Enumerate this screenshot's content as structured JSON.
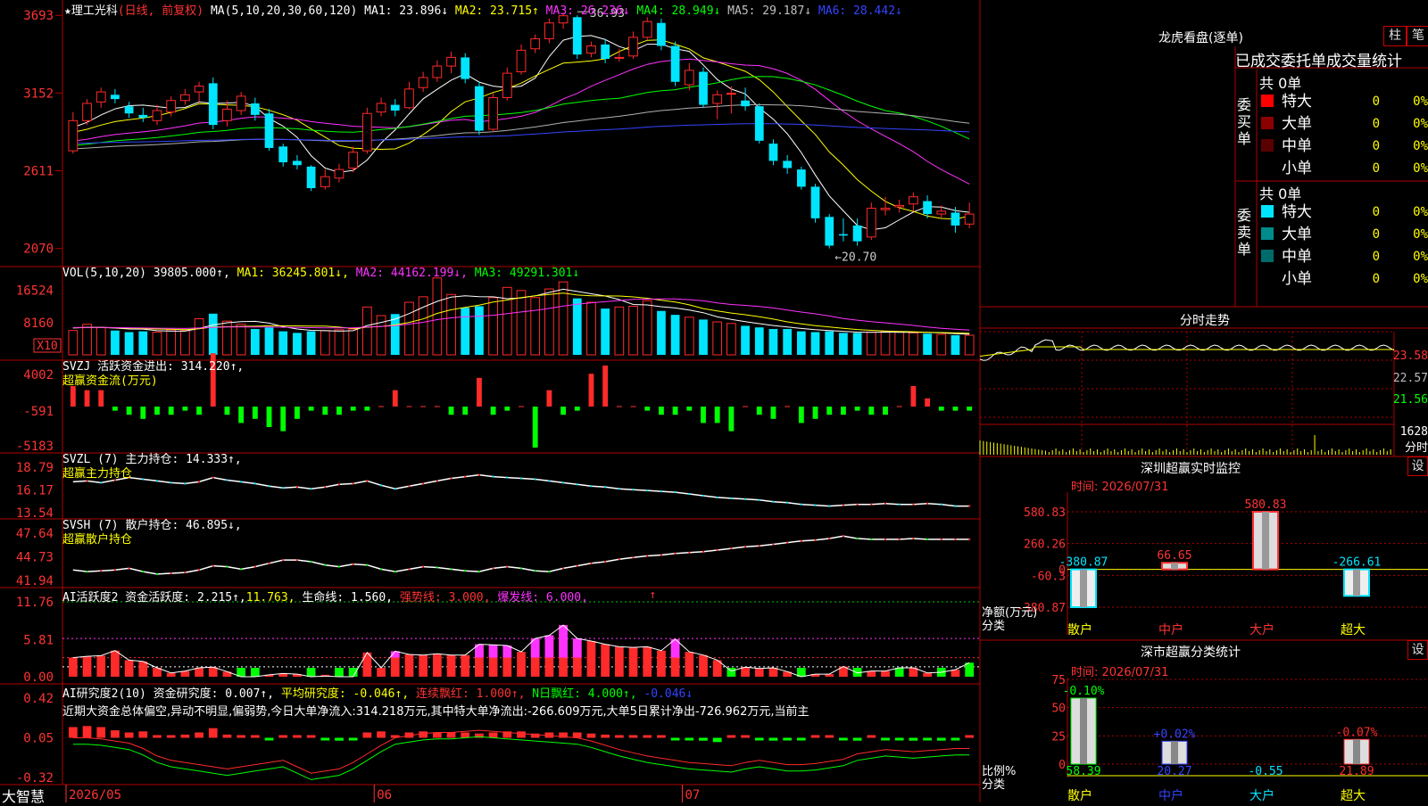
{
  "colors": {
    "bg": "#000000",
    "grid": "#b00000",
    "up": "#ff2a2a",
    "down": "#00e5ff",
    "ma1": "#ffffff",
    "ma2": "#ffff00",
    "ma3": "#ff33ff",
    "ma4": "#00ff00",
    "ma5": "#b0b0b0",
    "ma6": "#3344ff",
    "green": "#00ff00",
    "magenta": "#ff33ff",
    "yellow": "#ffff00"
  },
  "header": {
    "stock": "★理工光科",
    "mode": "(日线, 前复权)",
    "ma_params": "MA(5,10,20,30,60,120)",
    "ma1": "MA1: 23.896↓",
    "ma2": "MA2: 23.715↑",
    "ma3": "MA3: 26.236↓",
    "ma4": "MA4: 28.949↓",
    "ma5": "MA5: 29.187↓",
    "ma6": "MA6: 28.442↓"
  },
  "price_axis": [
    "3693",
    "3152",
    "2611",
    "2070"
  ],
  "price_annotations": {
    "high": "36.93",
    "low": "←20.70"
  },
  "vol": {
    "label": "VOL(5,10,20) 39805.000↑,",
    "ma1": "MA1: 36245.801↓,",
    "ma2": "MA2: 44162.199↓,",
    "ma3": "MA3: 49291.301↓",
    "axis": [
      "16524",
      "8160"
    ],
    "unit": "X10"
  },
  "svzj": {
    "label": "SVZJ  活跃资金进出: 314.220↑,",
    "sub": "超赢资金流(万元)",
    "axis": [
      "4002",
      "-591",
      "-5183"
    ]
  },
  "svzl": {
    "label": "SVZL (7) 主力持仓: 14.333↑,",
    "sub": "超赢主力持仓",
    "axis": [
      "18.79",
      "16.17",
      "13.54"
    ]
  },
  "svsh": {
    "label": "SVSH (7) 散户持仓: 46.895↓,",
    "sub": "超赢散户持仓",
    "axis": [
      "47.64",
      "44.73",
      "41.94"
    ]
  },
  "ai1": {
    "label": "AI活跃度2 资金活跃度: 2.215↑,",
    "v2": "11.763,",
    "life": "生命线: 1.560,",
    "strong": "强势线: 3.000,",
    "burst": "爆发线: 6.000,",
    "axis": [
      "11.76",
      "5.81",
      "0.00"
    ]
  },
  "ai2": {
    "label": "AI研究度2(10) 资金研究度: 0.007↑,",
    "avg": "平均研究度: -0.046↑,",
    "red": "连续飘红: 1.000↑,",
    "nday": "N日飘红: 4.000↑,",
    "last": "-0.046↓",
    "axis": [
      "0.42",
      "0.05",
      "-0.32"
    ],
    "commentary": "近期大资金总体偏空,异动不明显,偏弱势,今日大单净流入:314.218万元,其中特大单净流出:-266.609万元,大单5日累计净出-726.962万元,当前主"
  },
  "date_axis": [
    "2026/05",
    "06",
    "07"
  ],
  "brand": "大智慧",
  "right_panel": {
    "title": "龙虎看盘(逐单)",
    "btn1": "柱",
    "btn2": "笔",
    "tabs": "已成交委托单成交量统计",
    "buy_label": "委买单",
    "sell_label": "委卖单",
    "buy_total": "共 0单",
    "sell_total": "共 0单",
    "buy_rows": [
      {
        "name": "特大",
        "count": "0",
        "pct": "0%",
        "color": "#ff0000"
      },
      {
        "name": "大单",
        "count": "0",
        "pct": "0%",
        "color": "#8b0000"
      },
      {
        "name": "中单",
        "count": "0",
        "pct": "0%",
        "color": "#5a0000"
      },
      {
        "name": "小单",
        "count": "0",
        "pct": "0%",
        "color": "#000000"
      }
    ],
    "sell_rows": [
      {
        "name": "特大",
        "count": "0",
        "pct": "0%",
        "color": "#00e5ff"
      },
      {
        "name": "大单",
        "count": "0",
        "pct": "0%",
        "color": "#008b8b"
      },
      {
        "name": "中单",
        "count": "0",
        "pct": "0%",
        "color": "#006b6b"
      },
      {
        "name": "小单",
        "count": "0",
        "pct": "0%",
        "color": "#000000"
      }
    ],
    "intraday": {
      "title": "分时走势",
      "axis": [
        "23.58",
        "22.57",
        "21.56"
      ],
      "vol": "1628",
      "vol_unit": "分时"
    },
    "sz_monitor": {
      "title": "深圳超赢实时监控",
      "time": "时间: 2026/07/31",
      "btn": "设",
      "axis": [
        "580.83",
        "260.26",
        "0",
        "-60.3",
        "-380.87"
      ],
      "ylabel": "净额(万元)",
      "xlabel": "分类",
      "cats": [
        "散户",
        "中户",
        "大户",
        "超大"
      ],
      "values": [
        "-380.87",
        "66.65",
        "580.83",
        "-266.61"
      ]
    },
    "sz_class": {
      "title": "深市超赢分类统计",
      "time": "时间: 2026/07/31",
      "btn": "设",
      "axis": [
        "75",
        "50",
        "25",
        "0"
      ],
      "ylabel": "比例%",
      "xlabel": "分类",
      "cats": [
        "散户",
        "中户",
        "大户",
        "超大"
      ],
      "top": [
        "-0.10%",
        "+0.02%",
        "",
        "-0.07%"
      ],
      "bottom": [
        "58.39",
        "20.27",
        "-0.55",
        "21.89"
      ]
    }
  },
  "chart_data": {
    "type": "line",
    "title": "理工光科",
    "candles": [
      [
        27.5,
        29.6,
        30.2,
        27.3
      ],
      [
        29.6,
        30.8,
        31.1,
        29.3
      ],
      [
        30.9,
        31.6,
        31.9,
        30.5
      ],
      [
        31.4,
        31.1,
        31.8,
        30.8
      ],
      [
        30.6,
        30.1,
        30.9,
        29.8
      ],
      [
        30.0,
        29.8,
        30.5,
        29.5
      ],
      [
        29.6,
        30.3,
        30.7,
        29.3
      ],
      [
        30.2,
        31.0,
        31.3,
        29.9
      ],
      [
        31.0,
        31.4,
        31.8,
        30.7
      ],
      [
        31.6,
        32.0,
        32.3,
        30.9
      ],
      [
        32.2,
        29.3,
        32.6,
        29.0
      ],
      [
        29.6,
        30.4,
        31.0,
        29.2
      ],
      [
        30.3,
        31.3,
        31.6,
        30.0
      ],
      [
        30.8,
        30.0,
        31.2,
        29.6
      ],
      [
        30.1,
        27.7,
        30.4,
        27.5
      ],
      [
        27.8,
        26.7,
        28.0,
        26.4
      ],
      [
        26.8,
        26.5,
        27.2,
        26.2
      ],
      [
        26.4,
        24.9,
        26.5,
        24.7
      ],
      [
        25.0,
        25.7,
        26.2,
        24.8
      ],
      [
        25.6,
        26.2,
        26.6,
        25.3
      ],
      [
        26.3,
        27.4,
        27.8,
        26.0
      ],
      [
        27.5,
        30.1,
        30.5,
        27.3
      ],
      [
        30.2,
        30.8,
        31.2,
        29.9
      ],
      [
        30.7,
        30.3,
        31.1,
        29.9
      ],
      [
        30.5,
        31.8,
        32.3,
        30.4
      ],
      [
        31.9,
        32.6,
        33.0,
        31.6
      ],
      [
        32.6,
        33.4,
        33.8,
        32.3
      ],
      [
        33.4,
        34.0,
        34.4,
        32.9
      ],
      [
        34.0,
        32.5,
        34.3,
        32.2
      ],
      [
        32.0,
        28.9,
        32.3,
        28.6
      ],
      [
        29.0,
        31.2,
        31.5,
        28.8
      ],
      [
        31.2,
        32.9,
        33.3,
        31.0
      ],
      [
        33.0,
        34.5,
        34.9,
        32.8
      ],
      [
        34.6,
        35.3,
        35.6,
        34.3
      ],
      [
        35.3,
        36.4,
        36.7,
        35.0
      ],
      [
        36.4,
        36.9,
        37.1,
        36.0
      ],
      [
        36.8,
        34.2,
        36.93,
        33.9
      ],
      [
        34.3,
        34.8,
        35.1,
        34.0
      ],
      [
        34.9,
        33.9,
        35.3,
        33.6
      ],
      [
        34.0,
        34.0,
        34.6,
        33.7
      ],
      [
        34.1,
        35.4,
        35.8,
        33.9
      ],
      [
        35.4,
        36.5,
        36.8,
        35.2
      ],
      [
        36.4,
        34.8,
        36.7,
        34.5
      ],
      [
        34.8,
        32.3,
        35.1,
        32.0
      ],
      [
        32.1,
        33.1,
        33.6,
        31.7
      ],
      [
        33.0,
        30.7,
        33.3,
        30.5
      ],
      [
        30.8,
        31.4,
        31.7,
        29.7
      ],
      [
        31.5,
        31.5,
        32.0,
        30.1
      ],
      [
        31.0,
        30.6,
        31.9,
        30.3
      ],
      [
        30.6,
        28.2,
        30.8,
        28.0
      ],
      [
        28.0,
        26.8,
        28.3,
        26.5
      ],
      [
        26.8,
        26.3,
        27.2,
        25.9
      ],
      [
        26.2,
        25.0,
        26.4,
        24.8
      ],
      [
        25.0,
        22.8,
        25.2,
        22.5
      ],
      [
        22.9,
        20.9,
        23.1,
        20.7
      ],
      [
        21.7,
        21.6,
        22.8,
        21.2
      ],
      [
        22.3,
        21.2,
        22.8,
        20.9
      ],
      [
        21.5,
        23.5,
        23.9,
        21.3
      ],
      [
        23.4,
        23.5,
        24.3,
        23.0
      ],
      [
        23.6,
        23.7,
        24.1,
        23.2
      ],
      [
        23.8,
        24.3,
        24.6,
        23.3
      ],
      [
        24.0,
        23.1,
        24.4,
        22.8
      ],
      [
        23.1,
        23.3,
        23.7,
        22.8
      ],
      [
        23.2,
        22.3,
        23.6,
        21.8
      ],
      [
        22.4,
        23.1,
        23.9,
        22.1
      ]
    ],
    "volumes": [
      62,
      78,
      70,
      62,
      58,
      60,
      58,
      64,
      62,
      92,
      105,
      86,
      78,
      66,
      70,
      60,
      56,
      60,
      62,
      64,
      66,
      122,
      100,
      104,
      134,
      148,
      196,
      154,
      120,
      124,
      146,
      172,
      164,
      146,
      168,
      186,
      144,
      134,
      118,
      122,
      124,
      138,
      112,
      102,
      96,
      90,
      84,
      80,
      74,
      70,
      66,
      66,
      60,
      58,
      60,
      56,
      56,
      58,
      60,
      58,
      56,
      54,
      52,
      50,
      50
    ],
    "svzj": [
      5,
      4,
      4,
      -1,
      -2,
      -3,
      -2,
      -2,
      -1,
      -2,
      13,
      -2,
      -4,
      -3,
      -5,
      -6,
      -3,
      -1,
      -2,
      -2,
      -1,
      -1,
      0,
      4,
      0,
      0,
      0,
      -2,
      -2,
      7,
      -2,
      -1,
      0,
      -10,
      4,
      -2,
      -1,
      8,
      10,
      0,
      0,
      -1,
      -2,
      -2,
      -1,
      -4,
      -4,
      -6,
      0,
      -2,
      -3,
      0,
      -4,
      -3,
      -2,
      -2,
      -1,
      -2,
      -2,
      0,
      5,
      2,
      -1,
      -1,
      -1
    ],
    "svzl": [
      17.1,
      17.2,
      17.0,
      17.3,
      17.6,
      17.4,
      17.2,
      17.0,
      16.9,
      17.1,
      17.6,
      17.3,
      17.1,
      16.9,
      16.6,
      16.4,
      16.5,
      16.3,
      16.5,
      16.8,
      16.9,
      17.2,
      16.7,
      16.3,
      16.6,
      16.9,
      17.2,
      17.5,
      17.7,
      17.9,
      17.7,
      17.6,
      17.5,
      17.4,
      17.2,
      17.0,
      16.8,
      16.6,
      16.5,
      16.3,
      16.2,
      16.1,
      16.0,
      15.9,
      15.7,
      15.5,
      15.3,
      15.2,
      15.1,
      15.0,
      14.8,
      14.7,
      14.5,
      14.4,
      14.3,
      14.4,
      14.5,
      14.5,
      14.6,
      14.5,
      14.5,
      14.6,
      14.5,
      14.3,
      14.3
    ],
    "svsh": [
      43.2,
      43.0,
      43.1,
      43.2,
      43.4,
      43.0,
      42.7,
      42.8,
      42.9,
      43.2,
      43.7,
      43.6,
      43.3,
      43.6,
      44.0,
      44.4,
      44.4,
      44.2,
      43.8,
      43.6,
      43.9,
      43.8,
      43.3,
      43.0,
      43.3,
      43.6,
      43.5,
      43.3,
      43.1,
      43.0,
      43.4,
      43.6,
      43.4,
      43.1,
      43.0,
      43.4,
      43.7,
      44.0,
      44.2,
      44.5,
      44.7,
      44.9,
      45.0,
      45.2,
      45.3,
      45.4,
      45.6,
      45.8,
      46.0,
      46.1,
      46.3,
      46.5,
      46.7,
      46.8,
      47.0,
      47.3,
      47.0,
      46.9,
      46.9,
      46.9,
      47.0,
      46.9,
      46.9,
      46.9,
      46.9
    ],
    "ai1": [
      3.0,
      3.2,
      3.3,
      4.1,
      2.6,
      2.4,
      1.4,
      0.6,
      0.9,
      1.4,
      1.5,
      0.8,
      0.0,
      0.0,
      0.3,
      0.5,
      0.4,
      0.0,
      0.1,
      0.0,
      0.0,
      3.8,
      1.4,
      4.0,
      3.5,
      3.4,
      3.6,
      3.4,
      3.4,
      5.1,
      5.0,
      4.9,
      3.9,
      6.0,
      6.5,
      8.1,
      6.0,
      5.6,
      5.1,
      4.7,
      4.6,
      4.7,
      4.1,
      5.9,
      3.9,
      3.4,
      2.6,
      0.9,
      1.5,
      1.3,
      1.4,
      0.8,
      0.0,
      0.4,
      0.4,
      1.6,
      0.6,
      0.9,
      0.9,
      1.4,
      1.4,
      0.6,
      0.7,
      1.1,
      2.2
    ],
    "ai1_colors": [
      2,
      2,
      2,
      2,
      2,
      2,
      2,
      2,
      2,
      2,
      2,
      2,
      3,
      3,
      2,
      2,
      2,
      3,
      2,
      3,
      3,
      2,
      2,
      1,
      2,
      2,
      2,
      2,
      2,
      1,
      1,
      1,
      2,
      1,
      1,
      1,
      1,
      2,
      2,
      2,
      2,
      2,
      2,
      1,
      2,
      2,
      2,
      3,
      2,
      2,
      2,
      2,
      3,
      2,
      2,
      2,
      3,
      2,
      2,
      3,
      2,
      2,
      3,
      2,
      3
    ],
    "ai2": [
      0.1,
      0.11,
      0.1,
      0.07,
      0.05,
      0.06,
      0.0,
      0.02,
      0.03,
      0.05,
      0.09,
      0.03,
      0.02,
      0.01,
      -0.01,
      0.0,
      0.0,
      0.0,
      -0.01,
      -0.02,
      -0.01,
      0.05,
      0.06,
      0.02,
      0.05,
      0.06,
      0.05,
      0.05,
      0.05,
      0.04,
      0.05,
      0.06,
      0.06,
      0.04,
      0.05,
      0.05,
      0.05,
      0.04,
      0.03,
      0.02,
      0.02,
      0.01,
      0.0,
      -0.01,
      -0.01,
      -0.02,
      -0.03,
      0.0,
      0.01,
      -0.01,
      -0.02,
      -0.01,
      -0.01,
      0.0,
      0.0,
      -0.01,
      -0.02,
      0.0,
      -0.01,
      -0.01,
      -0.02,
      -0.01,
      -0.02,
      -0.01,
      0.0
    ],
    "ai2_avg": [
      0.05,
      0.05,
      0.04,
      0.02,
      0.0,
      -0.05,
      -0.12,
      -0.16,
      -0.18,
      -0.2,
      -0.22,
      -0.24,
      -0.22,
      -0.2,
      -0.18,
      -0.16,
      -0.22,
      -0.28,
      -0.26,
      -0.24,
      -0.18,
      -0.1,
      -0.02,
      0.05,
      0.07,
      0.09,
      0.1,
      0.1,
      0.11,
      0.12,
      0.11,
      0.1,
      0.09,
      0.08,
      0.07,
      0.06,
      0.05,
      0.02,
      -0.02,
      -0.06,
      -0.09,
      -0.12,
      -0.14,
      -0.16,
      -0.18,
      -0.19,
      -0.2,
      -0.21,
      -0.18,
      -0.16,
      -0.18,
      -0.2,
      -0.2,
      -0.19,
      -0.17,
      -0.15,
      -0.1,
      -0.08,
      -0.06,
      -0.07,
      -0.08,
      -0.07,
      -0.06,
      -0.05,
      -0.05
    ]
  }
}
